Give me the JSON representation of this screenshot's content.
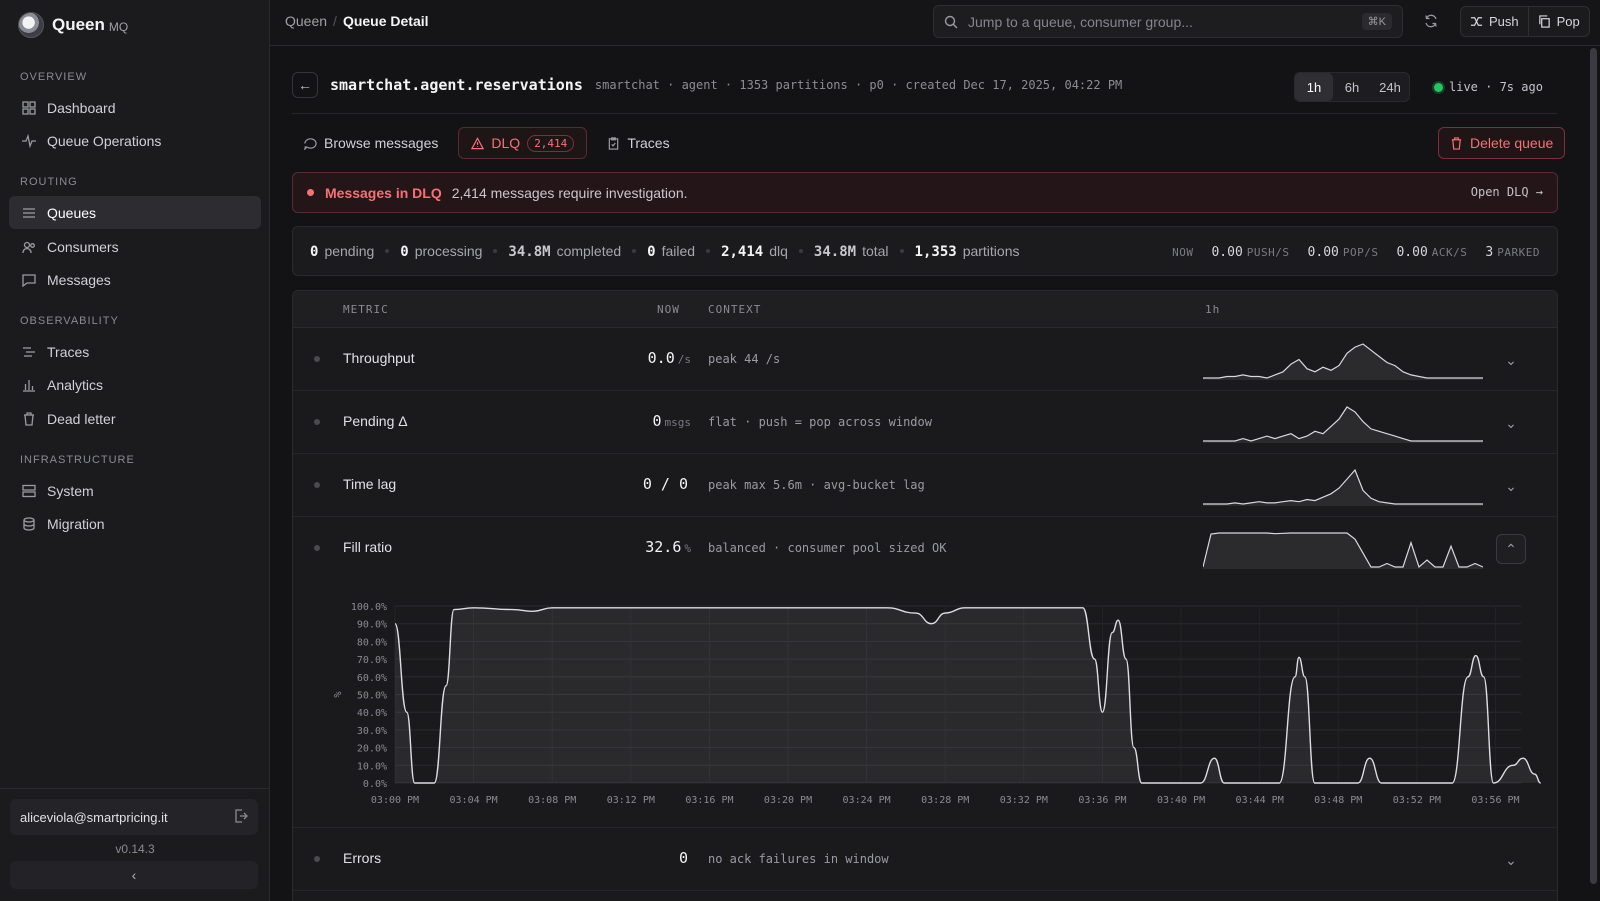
{
  "app": {
    "name": "Queen",
    "suffix": "MQ"
  },
  "sidebar": {
    "sections": [
      {
        "title": "OVERVIEW",
        "items": [
          {
            "label": "Dashboard",
            "icon": "dashboard-icon"
          },
          {
            "label": "Queue Operations",
            "icon": "activity-icon"
          }
        ]
      },
      {
        "title": "ROUTING",
        "items": [
          {
            "label": "Queues",
            "icon": "list-icon",
            "active": true
          },
          {
            "label": "Consumers",
            "icon": "users-icon"
          },
          {
            "label": "Messages",
            "icon": "message-icon"
          }
        ]
      },
      {
        "title": "OBSERVABILITY",
        "items": [
          {
            "label": "Traces",
            "icon": "traces-icon"
          },
          {
            "label": "Analytics",
            "icon": "bar-chart-icon"
          },
          {
            "label": "Dead letter",
            "icon": "trash-icon"
          }
        ]
      },
      {
        "title": "INFRASTRUCTURE",
        "items": [
          {
            "label": "System",
            "icon": "server-icon"
          },
          {
            "label": "Migration",
            "icon": "database-icon"
          }
        ]
      }
    ],
    "user_email": "aliceviola@smartpricing.it",
    "version": "v0.14.3"
  },
  "topbar": {
    "breadcrumb": [
      "Queen",
      "Queue Detail"
    ],
    "search_placeholder": "Jump to a queue, consumer group...",
    "search_shortcut": "⌘K",
    "push_label": "Push",
    "pop_label": "Pop"
  },
  "queue": {
    "name": "smartchat.agent.reservations",
    "meta": "smartchat · agent · 1353 partitions · p0 · created Dec 17, 2025, 04:22 PM",
    "ranges": [
      "1h",
      "6h",
      "24h"
    ],
    "active_range": "1h",
    "live_text": "live · 7s ago"
  },
  "tabs": {
    "browse": "Browse messages",
    "dlq": "DLQ",
    "dlq_count": "2,414",
    "traces": "Traces",
    "delete": "Delete queue"
  },
  "alert": {
    "title": "Messages in DLQ",
    "message": "2,414 messages require investigation.",
    "link": "Open DLQ →"
  },
  "stats": [
    {
      "value": "0",
      "label": "pending"
    },
    {
      "value": "0",
      "label": "processing"
    },
    {
      "value": "34.8M",
      "label": "completed"
    },
    {
      "value": "0",
      "label": "failed"
    },
    {
      "value": "2,414",
      "label": "dlq"
    },
    {
      "value": "34.8M",
      "label": "total"
    },
    {
      "value": "1,353",
      "label": "partitions"
    }
  ],
  "rates": {
    "now": "NOW",
    "push": "0.00",
    "push_lbl": "PUSH/S",
    "pop": "0.00",
    "pop_lbl": "POP/S",
    "ack": "0.00",
    "ack_lbl": "ACK/S",
    "parked": "3",
    "parked_lbl": "PARKED"
  },
  "metrics_table": {
    "headers": {
      "metric": "METRIC",
      "now": "NOW",
      "context": "CONTEXT",
      "window": "1h"
    },
    "rows": [
      {
        "name": "Throughput",
        "now": "0.0",
        "unit": "/s",
        "context": "peak 44 /s"
      },
      {
        "name": "Pending Δ",
        "now": "0",
        "unit": "msgs",
        "context": "flat · push = pop across window"
      },
      {
        "name": "Time lag",
        "now": "0 / 0",
        "unit": "",
        "context": "peak max 5.6m · avg-bucket lag"
      },
      {
        "name": "Fill ratio",
        "now": "32.6",
        "unit": "%",
        "context": "balanced · consumer pool sized OK"
      },
      {
        "name": "Errors",
        "now": "0",
        "unit": "",
        "context": "no ack failures in window"
      }
    ]
  },
  "chart_data": {
    "type": "area",
    "title": "",
    "xlabel": "",
    "ylabel": "%",
    "ylim": [
      0,
      100
    ],
    "y_ticks": [
      "0.0%",
      "10.0%",
      "20.0%",
      "30.0%",
      "40.0%",
      "50.0%",
      "60.0%",
      "70.0%",
      "80.0%",
      "90.0%",
      "100.0%"
    ],
    "x_ticks": [
      "03:00 PM",
      "03:04 PM",
      "03:08 PM",
      "03:12 PM",
      "03:16 PM",
      "03:20 PM",
      "03:24 PM",
      "03:28 PM",
      "03:32 PM",
      "03:36 PM",
      "03:40 PM",
      "03:44 PM",
      "03:48 PM",
      "03:52 PM",
      "03:56 PM"
    ],
    "series": [
      {
        "values": [
          [
            0,
            90
          ],
          [
            0.6,
            40
          ],
          [
            1,
            0
          ],
          [
            2,
            0
          ],
          [
            2.6,
            55
          ],
          [
            3,
            98
          ],
          [
            4,
            99
          ],
          [
            6,
            98
          ],
          [
            7,
            97
          ],
          [
            8,
            99
          ],
          [
            12,
            99
          ],
          [
            16,
            99
          ],
          [
            20,
            99
          ],
          [
            25,
            99
          ],
          [
            26.5,
            96
          ],
          [
            27.3,
            90
          ],
          [
            28,
            96
          ],
          [
            29,
            99
          ],
          [
            35,
            99
          ],
          [
            35.6,
            70
          ],
          [
            36,
            40
          ],
          [
            36.5,
            85
          ],
          [
            36.8,
            92
          ],
          [
            37.2,
            70
          ],
          [
            37.6,
            20
          ],
          [
            38,
            0
          ],
          [
            41,
            0
          ],
          [
            41.7,
            14
          ],
          [
            42.2,
            0
          ],
          [
            45,
            0
          ],
          [
            45.8,
            60
          ],
          [
            46,
            71
          ],
          [
            46.3,
            60
          ],
          [
            46.8,
            0
          ],
          [
            49,
            0
          ],
          [
            49.6,
            14
          ],
          [
            50.2,
            0
          ],
          [
            53.8,
            0
          ],
          [
            54.6,
            60
          ],
          [
            55,
            72
          ],
          [
            55.4,
            60
          ],
          [
            55.9,
            0
          ],
          [
            56.9,
            10
          ],
          [
            57.4,
            14
          ],
          [
            58,
            5
          ],
          [
            58.3,
            0
          ]
        ]
      }
    ]
  },
  "sparks": {
    "throughput": [
      0,
      0,
      0,
      1,
      1,
      2,
      1,
      1,
      0,
      2,
      4,
      9,
      12,
      6,
      4,
      7,
      5,
      8,
      16,
      20,
      22,
      18,
      14,
      10,
      8,
      4,
      2,
      1,
      0,
      0,
      0,
      0,
      0,
      0,
      0,
      0
    ],
    "pending": [
      0,
      0,
      0,
      0,
      0,
      1,
      0,
      1,
      2,
      1,
      2,
      3,
      1,
      2,
      4,
      3,
      6,
      9,
      14,
      12,
      8,
      5,
      4,
      3,
      2,
      1,
      0,
      0,
      0,
      0,
      0,
      0,
      0,
      0,
      0,
      0
    ],
    "timelag": [
      0,
      0,
      0,
      0,
      1,
      0,
      1,
      2,
      1,
      1,
      2,
      3,
      2,
      4,
      3,
      6,
      9,
      14,
      22,
      30,
      12,
      5,
      2,
      1,
      0,
      0,
      0,
      0,
      0,
      0,
      0,
      0,
      0,
      0,
      0,
      0
    ],
    "fill": [
      0,
      95,
      98,
      98,
      98,
      98,
      98,
      98,
      98,
      96,
      97,
      98,
      98,
      98,
      98,
      98,
      98,
      98,
      98,
      80,
      40,
      0,
      0,
      10,
      0,
      0,
      70,
      0,
      20,
      0,
      0,
      60,
      0,
      0,
      10,
      0
    ]
  }
}
